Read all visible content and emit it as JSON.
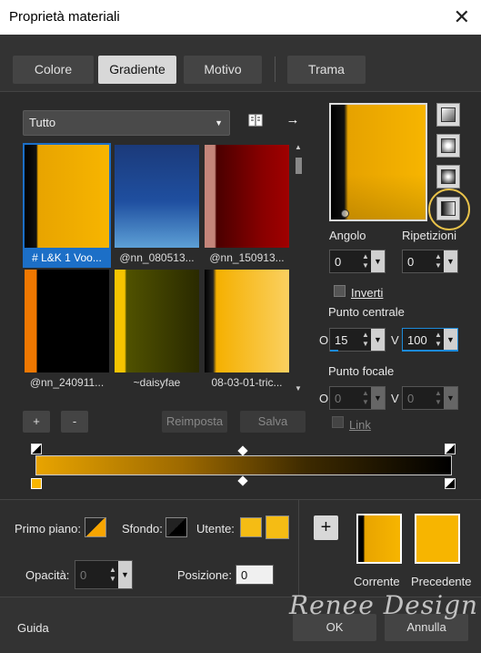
{
  "window": {
    "title": "Proprietà materiali",
    "close_glyph": "✕"
  },
  "tabs": [
    {
      "label": "Colore",
      "active": false
    },
    {
      "label": "Gradiente",
      "active": true
    },
    {
      "label": "Motivo",
      "active": false
    },
    {
      "label": "Trama",
      "active": false
    }
  ],
  "library": {
    "selected": "Tutto",
    "arrow_glyph": "→"
  },
  "thumbnails": [
    {
      "caption": "# L&K 1 Voo...",
      "selected": true
    },
    {
      "caption": "@nn_080513...",
      "selected": false
    },
    {
      "caption": "@nn_150913...",
      "selected": false
    },
    {
      "caption": "@nn_240911...",
      "selected": false
    },
    {
      "caption": "~daisyfae",
      "selected": false
    },
    {
      "caption": "08-03-01-tric...",
      "selected": false
    }
  ],
  "buttons": {
    "add": "+",
    "remove": "-",
    "reset": "Reimposta",
    "save": "Salva"
  },
  "settings": {
    "angle_label": "Angolo",
    "angle": "0",
    "repeats_label": "Ripetizioni",
    "repeats": "0",
    "invert_label": "Inverti",
    "center_label": "Punto centrale",
    "center_h_label": "O",
    "center_h": "15",
    "center_v_label": "V",
    "center_v": "100",
    "focal_label": "Punto focale",
    "focal_h_label": "O",
    "focal_h": "0",
    "focal_v_label": "V",
    "focal_v": "0",
    "link_label": "Link"
  },
  "stops": {
    "foreground_label": "Primo piano:",
    "background_label": "Sfondo:",
    "user_label": "Utente:",
    "opacity_label": "Opacità:",
    "opacity": "0",
    "position_label": "Posizione:",
    "position": "0"
  },
  "compare": {
    "add": "+",
    "current": "Corrente",
    "previous": "Precedente"
  },
  "footer": {
    "help": "Guida",
    "ok": "OK",
    "cancel": "Annulla"
  },
  "watermark": "Renee Design",
  "colors": {
    "accent": "#1c6fc7",
    "gold": "#f7b500",
    "highlight": "#e8c24a"
  }
}
